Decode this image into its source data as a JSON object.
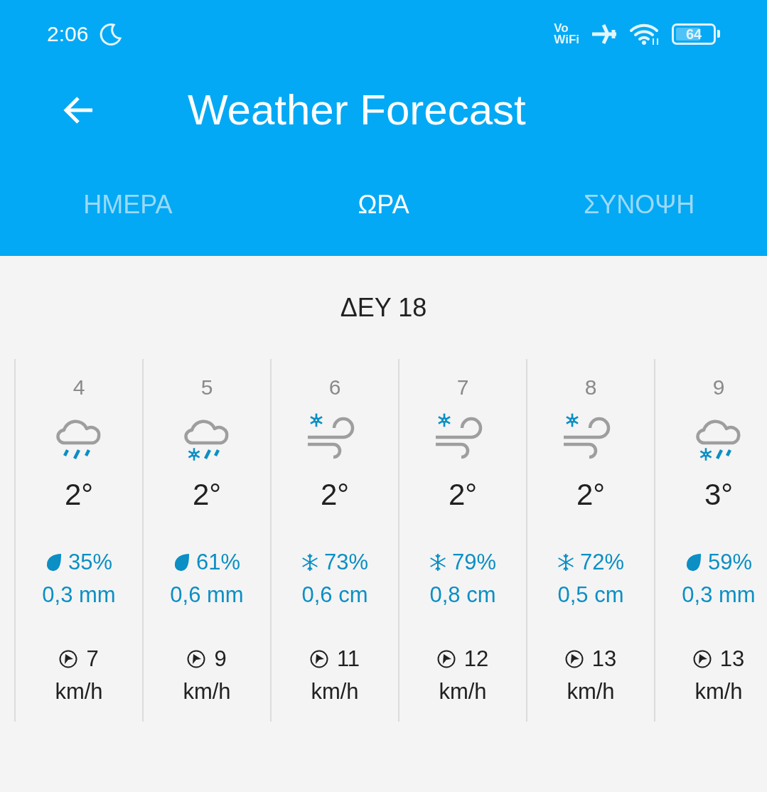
{
  "status_bar": {
    "time": "2:06",
    "network_top": "Vo",
    "network_bottom": "WiFi",
    "battery": "64"
  },
  "toolbar": {
    "title": "Weather Forecast"
  },
  "tabs": [
    {
      "label": "ΗΜΕΡΑ",
      "selected": false
    },
    {
      "label": "ΩΡΑ",
      "selected": true
    },
    {
      "label": "ΣΥΝΟΨΗ",
      "selected": false
    }
  ],
  "date": "ΔΕΥ 18",
  "hours": [
    {
      "hour": "4",
      "icon": {
        "kind": "rain"
      },
      "temp": "2°",
      "precipitation": {
        "kind": "rain",
        "chance": "35%",
        "amount": "0,3 mm"
      },
      "wind": "7",
      "wind_unit": "km/h"
    },
    {
      "hour": "5",
      "icon": {
        "kind": "sleet"
      },
      "temp": "2°",
      "precipitation": {
        "kind": "rain",
        "chance": "61%",
        "amount": "0,6 mm"
      },
      "wind": "9",
      "wind_unit": "km/h"
    },
    {
      "hour": "6",
      "icon": {
        "kind": "snowwind"
      },
      "temp": "2°",
      "precipitation": {
        "kind": "snow",
        "chance": "73%",
        "amount": "0,6 cm"
      },
      "wind": "11",
      "wind_unit": "km/h"
    },
    {
      "hour": "7",
      "icon": {
        "kind": "snowwind"
      },
      "temp": "2°",
      "precipitation": {
        "kind": "snow",
        "chance": "79%",
        "amount": "0,8 cm"
      },
      "wind": "12",
      "wind_unit": "km/h"
    },
    {
      "hour": "8",
      "icon": {
        "kind": "snowwind"
      },
      "temp": "2°",
      "precipitation": {
        "kind": "snow",
        "chance": "72%",
        "amount": "0,5 cm"
      },
      "wind": "13",
      "wind_unit": "km/h"
    },
    {
      "hour": "9",
      "icon": {
        "kind": "sleet"
      },
      "temp": "3°",
      "precipitation": {
        "kind": "rain",
        "chance": "59%",
        "amount": "0,3 mm"
      },
      "wind": "13",
      "wind_unit": "km/h"
    }
  ]
}
